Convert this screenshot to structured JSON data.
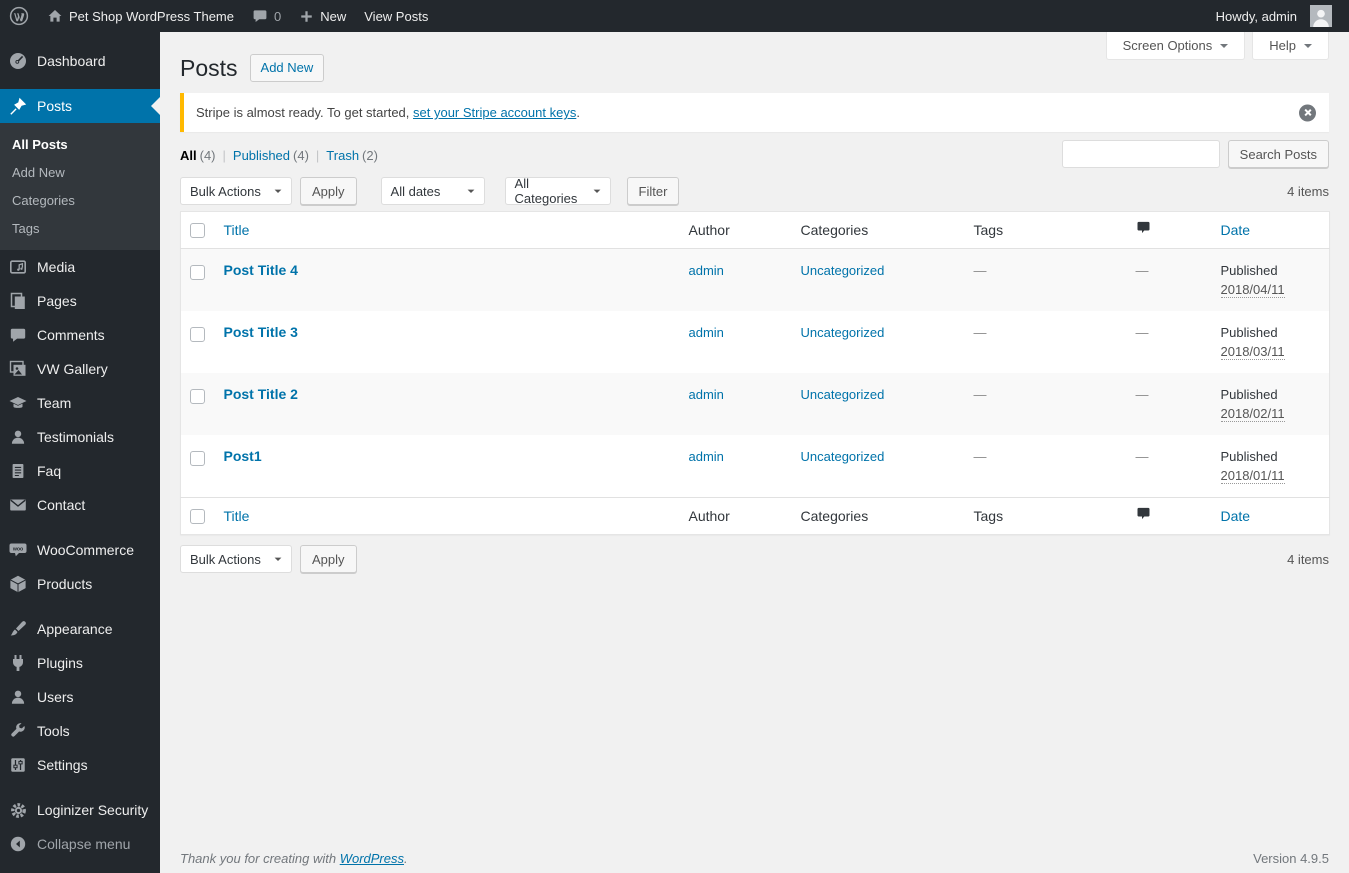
{
  "colors": {
    "accent": "#0073aa",
    "adminbar_bg": "#23282d",
    "submenu_bg": "#32373c",
    "notice_accent": "#ffb900",
    "icon_muted": "#a0a5aa",
    "content_bg": "#f1f1f1"
  },
  "admin_bar": {
    "site_name": "Pet Shop WordPress Theme",
    "comment_count": "0",
    "new_label": "New",
    "view_posts_label": "View Posts",
    "howdy": "Howdy, admin"
  },
  "screen_meta": {
    "screen_options": "Screen Options",
    "help": "Help"
  },
  "sidebar": {
    "items": [
      {
        "label": "Dashboard",
        "icon": "dashboard-icon"
      },
      {
        "label": "Posts",
        "icon": "pushpin-icon",
        "active": true
      },
      {
        "label": "Media",
        "icon": "media-icon"
      },
      {
        "label": "Pages",
        "icon": "pages-icon"
      },
      {
        "label": "Comments",
        "icon": "comments-icon"
      },
      {
        "label": "VW Gallery",
        "icon": "gallery-icon"
      },
      {
        "label": "Team",
        "icon": "team-icon"
      },
      {
        "label": "Testimonials",
        "icon": "testimonial-icon"
      },
      {
        "label": "Faq",
        "icon": "faq-icon"
      },
      {
        "label": "Contact",
        "icon": "envelope-icon"
      },
      {
        "label": "WooCommerce",
        "icon": "woocommerce-icon"
      },
      {
        "label": "Products",
        "icon": "box-icon"
      },
      {
        "label": "Appearance",
        "icon": "paintbrush-icon"
      },
      {
        "label": "Plugins",
        "icon": "plug-icon"
      },
      {
        "label": "Users",
        "icon": "user-icon"
      },
      {
        "label": "Tools",
        "icon": "wrench-icon"
      },
      {
        "label": "Settings",
        "icon": "sliders-icon"
      },
      {
        "label": "Loginizer Security",
        "icon": "gear-icon"
      }
    ],
    "posts_submenu": [
      "All Posts",
      "Add New",
      "Categories",
      "Tags"
    ],
    "collapse_label": "Collapse menu"
  },
  "page": {
    "title": "Posts",
    "add_new_label": "Add New"
  },
  "notice": {
    "message": "Stripe is almost ready. To get started, ",
    "link_text": "set your Stripe account keys",
    "suffix": "."
  },
  "views": {
    "all": "All",
    "all_count": "(4)",
    "divider": "|",
    "published": "Published",
    "published_count": "(4)",
    "trash": "Trash",
    "trash_count": "(2)"
  },
  "search": {
    "input_value": "",
    "button_label": "Search Posts"
  },
  "tablenav": {
    "bulk_actions": "Bulk Actions",
    "apply_label": "Apply",
    "all_dates": "All dates",
    "all_categories": "All Categories",
    "filter_label": "Filter",
    "items_count": "4 items"
  },
  "table": {
    "headers": {
      "title": "Title",
      "author": "Author",
      "categories": "Categories",
      "tags": "Tags",
      "date": "Date"
    },
    "rows": [
      {
        "title": "Post Title 4",
        "author": "admin",
        "categories": "Uncategorized",
        "tags": "—",
        "comments": "—",
        "status": "Published",
        "date": "2018/04/11"
      },
      {
        "title": "Post Title 3",
        "author": "admin",
        "categories": "Uncategorized",
        "tags": "—",
        "comments": "—",
        "status": "Published",
        "date": "2018/03/11"
      },
      {
        "title": "Post Title 2",
        "author": "admin",
        "categories": "Uncategorized",
        "tags": "—",
        "comments": "—",
        "status": "Published",
        "date": "2018/02/11"
      },
      {
        "title": "Post1",
        "author": "admin",
        "categories": "Uncategorized",
        "tags": "—",
        "comments": "—",
        "status": "Published",
        "date": "2018/01/11"
      }
    ]
  },
  "footer": {
    "thanks": "Thank you for creating with ",
    "link_text": "WordPress",
    "suffix": ".",
    "version": "Version 4.9.5"
  }
}
